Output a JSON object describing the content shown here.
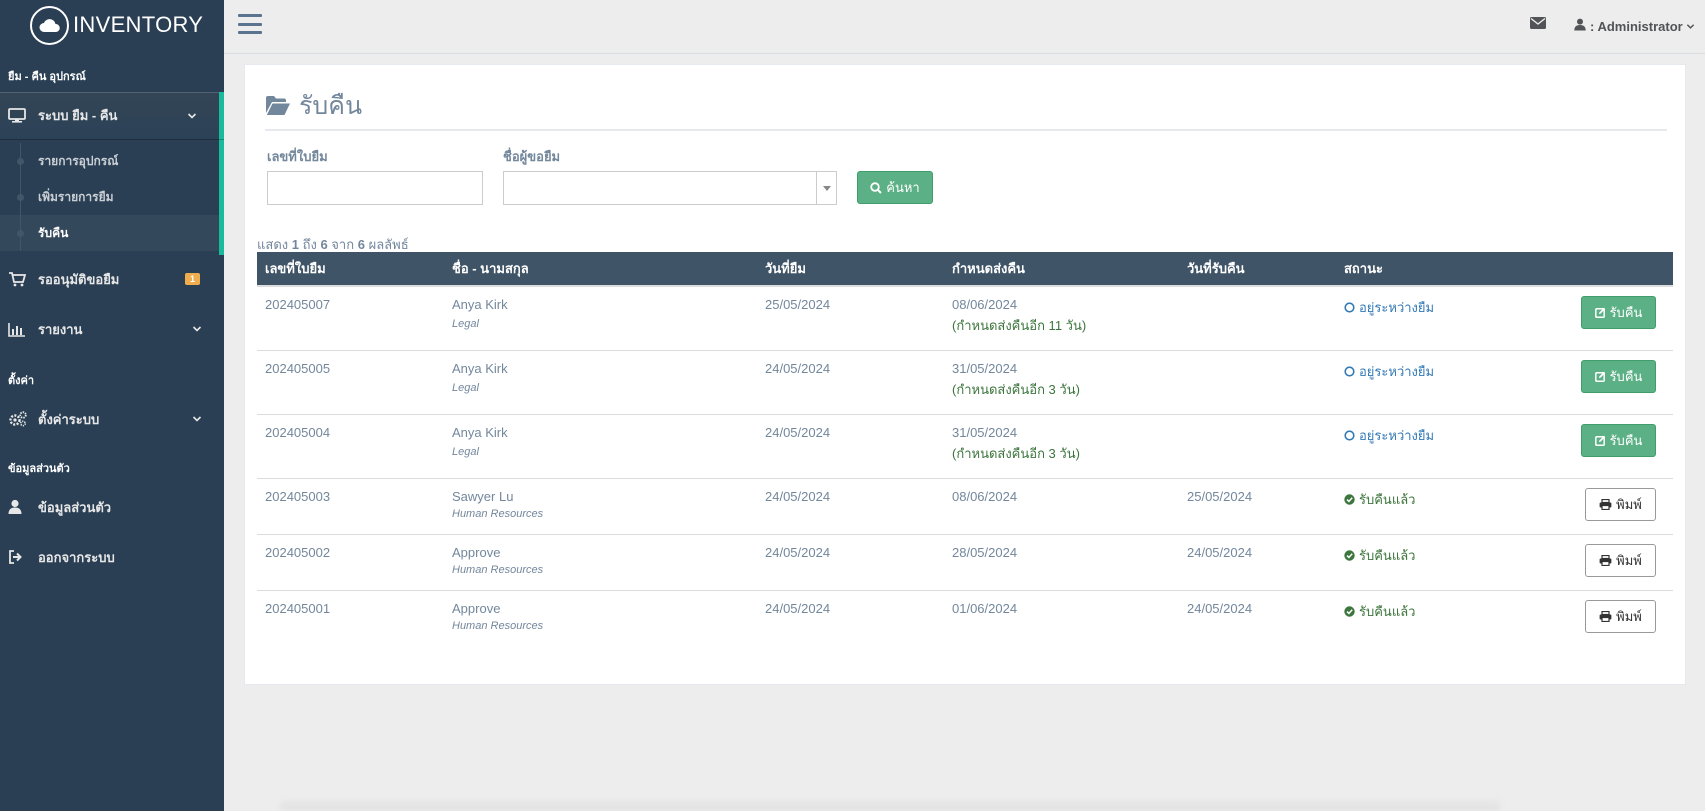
{
  "app": {
    "brand": "INVENTORY"
  },
  "sidebar": {
    "sections": [
      "ยืม - คืน อุปกรณ์",
      "ตั้งค่า",
      "ข้อมูลส่วนตัว"
    ],
    "borrow_system": {
      "label": "ระบบ ยืม - คืน"
    },
    "sub_items": [
      {
        "label": "รายการอุปกรณ์"
      },
      {
        "label": "เพิ่มรายการยืม"
      },
      {
        "label": "รับคืน"
      }
    ],
    "pending": {
      "label": "รออนุมัติขอยืม",
      "badge": "1"
    },
    "reports": {
      "label": "รายงาน"
    },
    "settings": {
      "label": "ตั้งค่าระบบ"
    },
    "profile": {
      "label": "ข้อมูลส่วนตัว"
    },
    "logout": {
      "label": "ออกจากระบบ"
    }
  },
  "topnav": {
    "user_label": ": Administrator"
  },
  "page": {
    "title": "รับคืน",
    "filters": {
      "doc_no_label": "เลขที่ใบยืม",
      "doc_no_value": "",
      "borrower_label": "ชื่อผู้ขอยืม",
      "borrower_value": "",
      "search_button": "ค้นหา"
    },
    "result_info": {
      "prefix": "แสดง",
      "from": "1",
      "to_word": "ถึง",
      "to": "6",
      "of_word": "จาก",
      "total": "6",
      "suffix": "ผลลัพธ์"
    },
    "table": {
      "headers": [
        "เลขที่ใบยืม",
        "ชื่อ - นามสกุล",
        "วันที่ยืม",
        "กำหนดส่งคืน",
        "วันที่รับคืน",
        "สถานะ",
        ""
      ],
      "rows": [
        {
          "doc_no": "202405007",
          "name": "Anya Kirk",
          "dept": "Legal",
          "borrow_date": "25/05/2024",
          "due_date": "08/06/2024",
          "due_note": "(กำหนดส่งคืนอีก 11 วัน)",
          "return_date": "",
          "status": "อยู่ระหว่างยืม",
          "action": "รับคืน"
        },
        {
          "doc_no": "202405005",
          "name": "Anya Kirk",
          "dept": "Legal",
          "borrow_date": "24/05/2024",
          "due_date": "31/05/2024",
          "due_note": "(กำหนดส่งคืนอีก 3 วัน)",
          "return_date": "",
          "status": "อยู่ระหว่างยืม",
          "action": "รับคืน"
        },
        {
          "doc_no": "202405004",
          "name": "Anya Kirk",
          "dept": "Legal",
          "borrow_date": "24/05/2024",
          "due_date": "31/05/2024",
          "due_note": "(กำหนดส่งคืนอีก 3 วัน)",
          "return_date": "",
          "status": "อยู่ระหว่างยืม",
          "action": "รับคืน"
        },
        {
          "doc_no": "202405003",
          "name": "Sawyer Lu",
          "dept": "Human Resources",
          "borrow_date": "24/05/2024",
          "due_date": "08/06/2024",
          "due_note": "",
          "return_date": "25/05/2024",
          "status": "รับคืนแล้ว",
          "action": "พิมพ์"
        },
        {
          "doc_no": "202405002",
          "name": "Approve",
          "dept": "Human Resources",
          "borrow_date": "24/05/2024",
          "due_date": "28/05/2024",
          "due_note": "",
          "return_date": "24/05/2024",
          "status": "รับคืนแล้ว",
          "action": "พิมพ์"
        },
        {
          "doc_no": "202405001",
          "name": "Approve",
          "dept": "Human Resources",
          "borrow_date": "24/05/2024",
          "due_date": "01/06/2024",
          "due_note": "",
          "return_date": "24/05/2024",
          "status": "รับคืนแล้ว",
          "action": "พิมพ์"
        }
      ]
    }
  },
  "colors": {
    "sidebar_bg": "#2a3f54",
    "active_accent": "#1abb9c",
    "success_button": "#5cb085",
    "table_header": "#405467",
    "status_borrow": "#337ab7",
    "status_returned": "#3c763d",
    "badge": "#f0ad4e"
  },
  "icons": {
    "brand": "cloud-icon",
    "borrow_system": "desktop-icon",
    "pending": "cart-icon",
    "reports": "bar-chart-icon",
    "settings": "gears-icon",
    "profile": "user-icon",
    "logout": "sign-out-icon",
    "title": "folder-open-icon",
    "search": "search-icon",
    "return": "edit-icon",
    "print": "print-icon",
    "status_borrow": "circle-outline-icon",
    "status_returned": "check-circle-icon",
    "mail": "envelope-icon",
    "user": "user-icon"
  }
}
